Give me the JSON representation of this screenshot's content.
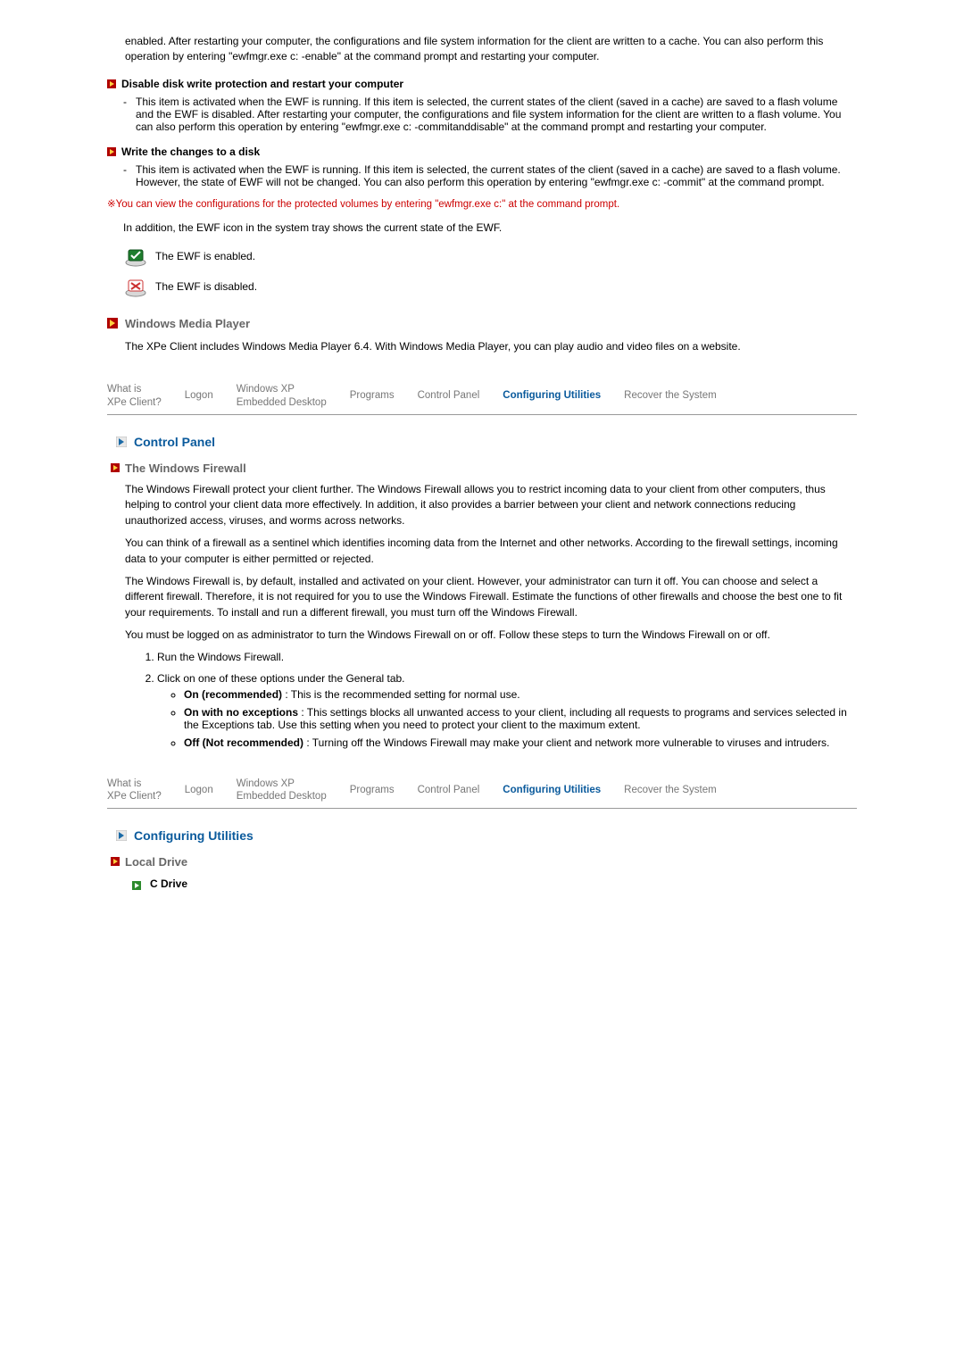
{
  "intro_para": "enabled. After restarting your computer, the configurations and file system information for the client are written to a cache. You can also perform this operation by entering \"ewfmgr.exe c: -enable\" at the command prompt and restarting your computer.",
  "disable": {
    "title": "Disable disk write protection and restart your computer",
    "body": "This item is activated when the EWF is running. If this item is selected, the current states of the client (saved in a cache) are saved to a flash volume and the EWF is disabled. After restarting your computer, the configurations and file system information for the client are written to a flash volume. You can also perform this operation by entering \"ewfmgr.exe c: -commitanddisable\" at the command prompt and restarting your computer."
  },
  "write_changes": {
    "title": "Write the changes to a disk",
    "body": "This item is activated when the EWF is running. If this item is selected, the current states of the client (saved in a cache) are saved to a flash volume. However, the state of EWF will not be changed. You can also perform this operation by entering \"ewfmgr.exe c: -commit\" at the command prompt."
  },
  "note": "※You can view the configurations for the protected volumes by entering \"ewfmgr.exe c:\" at the command prompt.",
  "tray_intro": "In addition, the EWF icon in the system tray shows the current state of the EWF.",
  "ewf_enabled": "The EWF is enabled.",
  "ewf_disabled": "The EWF is disabled.",
  "wmp": {
    "title": "Windows Media Player",
    "body": "The XPe Client includes Windows Media Player 6.4. With Windows Media Player, you can play audio and video files on a website."
  },
  "tabs": {
    "what": "What is\nXPe Client?",
    "logon": "Logon",
    "wxe": "Windows XP\nEmbedded Desktop",
    "programs": "Programs",
    "cp": "Control Panel",
    "cu": "Configuring Utilities",
    "rs": "Recover the System"
  },
  "control_panel": {
    "title": "Control Panel",
    "sub": "The Windows Firewall",
    "p1": "The Windows Firewall protect your client further. The Windows Firewall allows you to restrict incoming data to your client from other computers, thus helping to control your client data more effectively. In addition, it also provides a barrier between your client and network connections reducing unauthorized access, viruses, and worms across networks.",
    "p2": "You can think of a firewall as a sentinel which identifies incoming data from the Internet and other networks. According to the firewall settings, incoming data to your computer is either permitted or rejected.",
    "p3": "The Windows Firewall is, by default, installed and activated on your client. However, your administrator can turn it off. You can choose and select a different firewall. Therefore, it is not required for you to use the Windows Firewall. Estimate the functions of other firewalls and choose the best one to fit your requirements. To install and run a different firewall, you must turn off the Windows Firewall.",
    "p4": "You must be logged on as administrator to turn the Windows Firewall on or off. Follow these steps to turn the Windows Firewall on or off.",
    "li1": "Run the Windows Firewall.",
    "li2": "Click on one of these options under the General tab.",
    "opt1_label": "On (recommended)",
    "opt1_text": " : This is the recommended setting for normal use.",
    "opt2_label": "On with no exceptions",
    "opt2_text": " : This settings blocks all unwanted access to your client, including all requests to programs and services selected in the Exceptions tab. Use this setting when you need to protect your client to the maximum extent.",
    "opt3_label": "Off (Not recommended)",
    "opt3_text": " : Turning off the Windows Firewall may make your client and network more vulnerable to viruses and intruders."
  },
  "config_util": {
    "title": "Configuring Utilities",
    "local_drive": "Local Drive",
    "c_drive": "C Drive"
  }
}
